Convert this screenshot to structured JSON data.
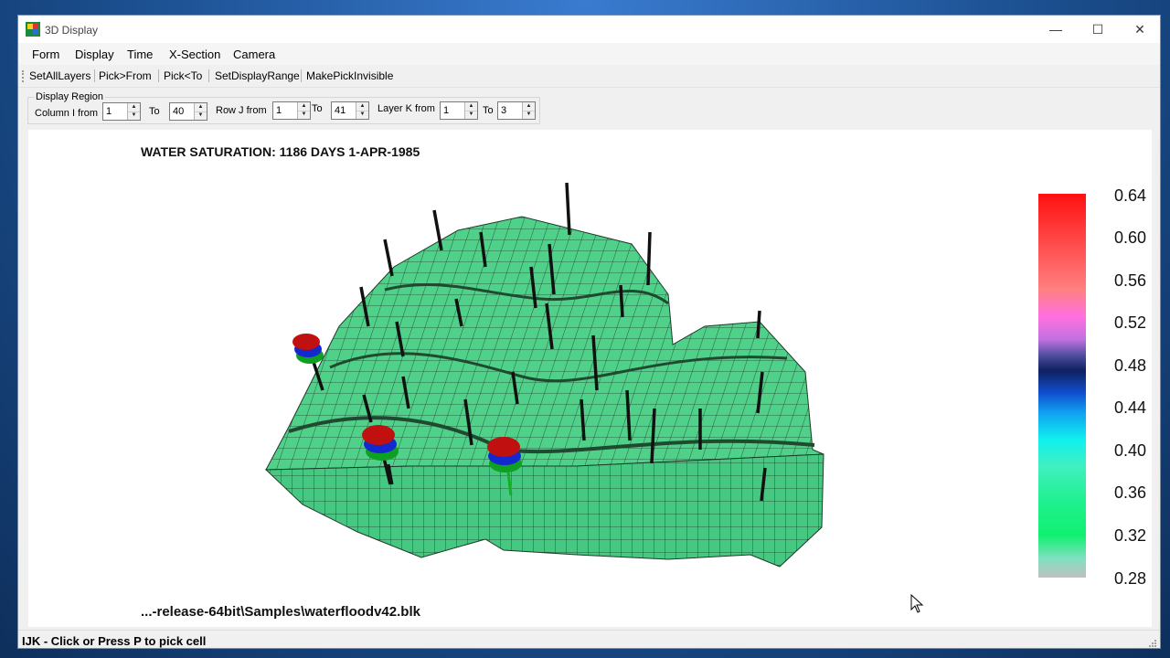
{
  "window": {
    "title": "3D Display",
    "controls": {
      "minimize": "—",
      "maximize": "☐",
      "close": "✕"
    }
  },
  "menu": [
    "Form",
    "Display",
    "Time",
    "X-Section",
    "Camera"
  ],
  "toolbar": [
    "SetAllLayers",
    "Pick>From",
    "Pick<To",
    "SetDisplayRange",
    "MakePickInvisible"
  ],
  "region": {
    "legend": "Display Region",
    "column_from_label": "Column I from",
    "column_from": "1",
    "column_to_label": "To",
    "column_to": "40",
    "row_from_label": "Row J from",
    "row_from": "1",
    "row_to_label": "To",
    "row_to": "41",
    "layer_from_label": "Layer K from",
    "layer_from": "1",
    "layer_to_label": "To",
    "layer_to": "3"
  },
  "plot": {
    "title": "WATER SATURATION: 1186 DAYS 1-APR-1985",
    "file": "...-release-64bit\\Samples\\waterfloodv42.blk",
    "colorbar_ticks": [
      "0.64",
      "0.60",
      "0.56",
      "0.52",
      "0.48",
      "0.44",
      "0.40",
      "0.36",
      "0.32",
      "0.28"
    ],
    "colorbar_range": [
      0.28,
      0.64
    ],
    "colorbar_stops": [
      {
        "value": 0.64,
        "color": "#ff1010"
      },
      {
        "value": 0.59,
        "color": "#ff5050"
      },
      {
        "value": 0.55,
        "color": "#ff8080"
      },
      {
        "value": 0.525,
        "color": "#ff70e0"
      },
      {
        "value": 0.505,
        "color": "#c070e0"
      },
      {
        "value": 0.49,
        "color": "#5050a0"
      },
      {
        "value": 0.475,
        "color": "#102060"
      },
      {
        "value": 0.455,
        "color": "#1050d0"
      },
      {
        "value": 0.435,
        "color": "#10a0f0"
      },
      {
        "value": 0.41,
        "color": "#10f0f0"
      },
      {
        "value": 0.385,
        "color": "#40f0c0"
      },
      {
        "value": 0.355,
        "color": "#20f090"
      },
      {
        "value": 0.32,
        "color": "#10f070"
      },
      {
        "value": 0.3,
        "color": "#80e0c0"
      },
      {
        "value": 0.28,
        "color": "#c0c0c0"
      }
    ],
    "surface_color": "#4fd18a",
    "grid_color": "#1e3a28"
  },
  "status": "IJK - Click or Press P to pick cell"
}
